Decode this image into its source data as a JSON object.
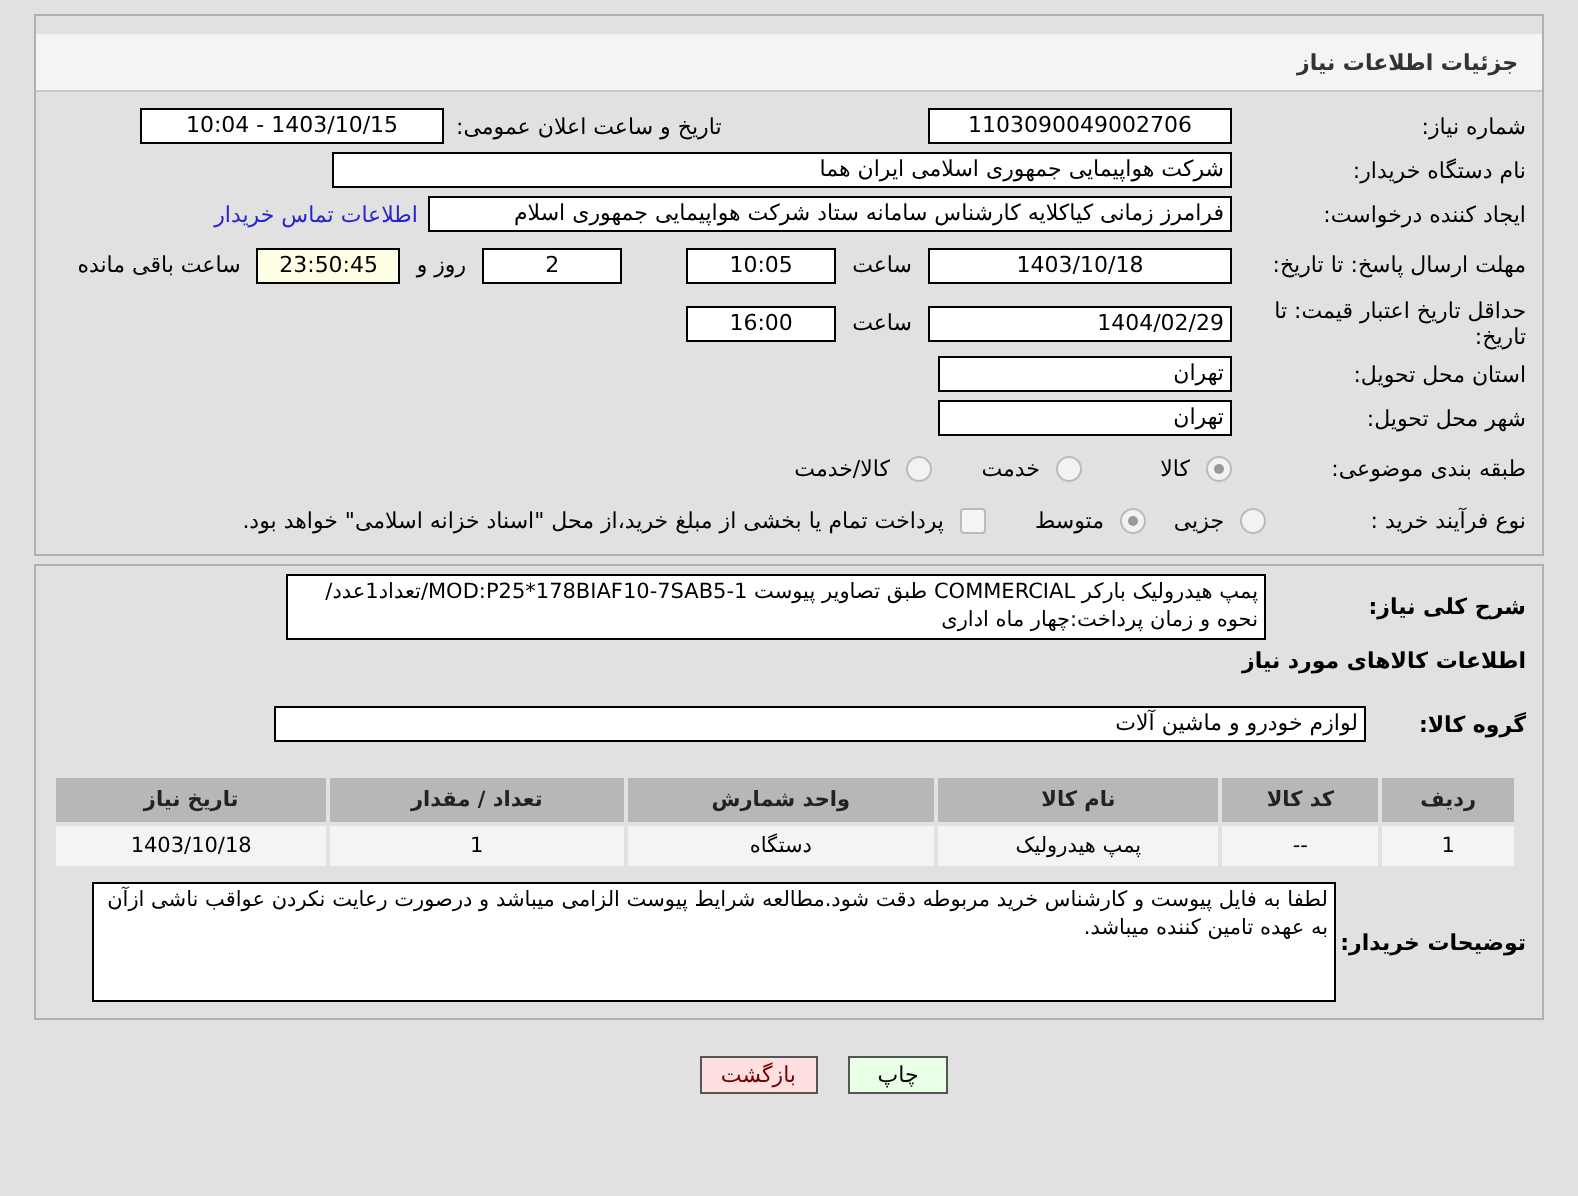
{
  "header": {
    "title": "جزئیات اطلاعات نیاز"
  },
  "need_number": {
    "label": "شماره نیاز:",
    "value": "1103090049002706"
  },
  "announce": {
    "label": "تاریخ و ساعت اعلان عمومی:",
    "value": "1403/10/15 - 10:04"
  },
  "buyer_org": {
    "label": "نام دستگاه خریدار:",
    "value": "شرکت هواپیمایی جمهوری اسلامی ایران هما"
  },
  "requester": {
    "label": "ایجاد کننده درخواست:",
    "value": "فرامرز زمانی کیاکلایه کارشناس سامانه ستاد شرکت هواپیمایی جمهوری اسلام",
    "link": "اطلاعات تماس خریدار"
  },
  "reply_deadline": {
    "label": "مهلت ارسال پاسخ: تا تاریخ:",
    "date": "1403/10/18",
    "time_label": "ساعت",
    "time": "10:05",
    "days": "2",
    "days_label": "روز و",
    "remaining": "23:50:45",
    "remaining_label": "ساعت باقی مانده"
  },
  "price_validity": {
    "label": "حداقل تاریخ اعتبار قیمت: تا تاریخ:",
    "date": "1404/02/29",
    "time_label": "ساعت",
    "time": "16:00"
  },
  "province": {
    "label": "استان محل تحویل:",
    "value": "تهران"
  },
  "city": {
    "label": "شهر محل تحویل:",
    "value": "تهران"
  },
  "category": {
    "label": "طبقه بندی موضوعی:",
    "options": [
      {
        "label": "کالا",
        "selected": true
      },
      {
        "label": "خدمت",
        "selected": false
      },
      {
        "label": "کالا/خدمت",
        "selected": false
      }
    ]
  },
  "process": {
    "label": "نوع فرآیند خرید :",
    "options": [
      {
        "label": "جزیی",
        "selected": false
      },
      {
        "label": "متوسط",
        "selected": true
      }
    ],
    "treasury": {
      "label": "پرداخت تمام یا بخشی از مبلغ خرید،از محل \"اسناد خزانه اسلامی\" خواهد بود.",
      "checked": false
    }
  },
  "description": {
    "label": "شرح کلی نیاز:",
    "value": "پمپ  هیدرولیک بارکر COMMERCIAL طبق تصاویر پیوست MOD:P25*178BIAF10-7SAB5-1/تعداد1عدد/نحوه و زمان پرداخت:چهار ماه اداری"
  },
  "goods_title": "اطلاعات کالاهای مورد نیاز",
  "goods_group": {
    "label": "گروه کالا:",
    "value": "لوازم خودرو و ماشین آلات"
  },
  "table": {
    "columns": [
      "ردیف",
      "کد کالا",
      "نام کالا",
      "واحد شمارش",
      "تعداد / مقدار",
      "تاریخ نیاز"
    ],
    "rows": [
      [
        "1",
        "--",
        "پمپ هیدرولیک",
        "دستگاه",
        "1",
        "1403/10/18"
      ]
    ]
  },
  "buyer_notes": {
    "label": "توضیحات خریدار:",
    "value": "لطفا به فایل پیوست و کارشناس خرید مربوطه دقت شود.مطالعه شرایط پیوست الزامی میباشد و درصورت رعایت نکردن عواقب ناشی ازآن به عهده تامین کننده میباشد."
  },
  "buttons": [
    {
      "label": "چاپ",
      "kind": "print"
    },
    {
      "label": "بازگشت",
      "kind": "back"
    }
  ]
}
